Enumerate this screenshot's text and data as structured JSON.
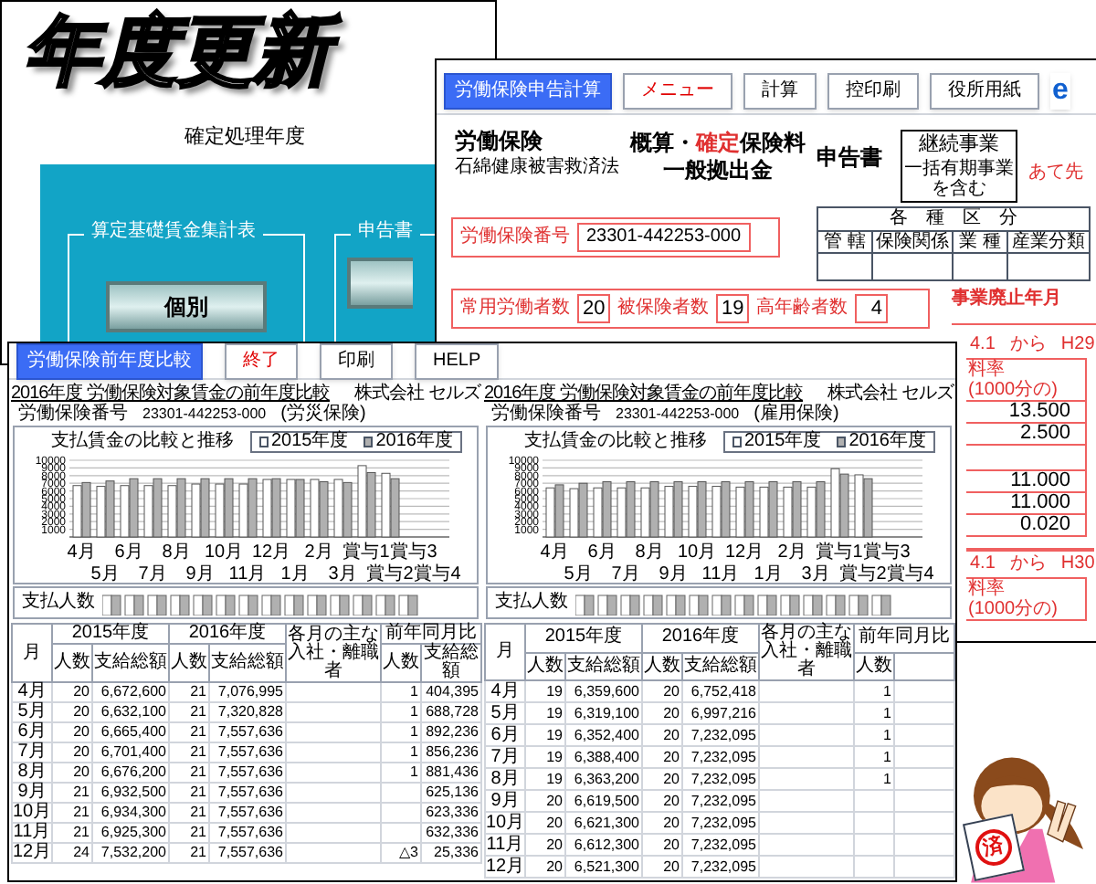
{
  "year_update_window": {
    "title": "年度更新",
    "subtitle": "確定処理年度",
    "groups": [
      {
        "label": "算定基礎賃金集計表",
        "buttons": [
          "個別"
        ]
      },
      {
        "label": "申告書"
      }
    ]
  },
  "declaration_window": {
    "toolbar": [
      {
        "label": "労働保険申告計算",
        "kind": "title"
      },
      {
        "label": "メニュー",
        "kind": "menu"
      },
      {
        "label": "計算",
        "kind": "button"
      },
      {
        "label": "控印刷",
        "kind": "button"
      },
      {
        "label": "役所用紙",
        "kind": "button"
      },
      {
        "label": "e",
        "kind": "logo"
      }
    ],
    "law_title": "労働保険",
    "law_subtitle": "石綿健康被害救済法",
    "heading_line_1": [
      {
        "text": "概算・",
        "kind": "plain"
      },
      {
        "text": "確定",
        "kind": "emphasis"
      },
      {
        "text": "保険料",
        "kind": "plain"
      }
    ],
    "heading_line_2": "一般拠出金",
    "heading_suffix": "申告書",
    "business_box": {
      "title": "継続事業",
      "note": "一括有期事業を含む"
    },
    "addressee": "あて先",
    "category_table": {
      "title": "各　種　区　分",
      "columns": [
        "管 轄",
        "保険関係",
        "業 種",
        "産業分類"
      ]
    },
    "insurance_number": {
      "label": "労働保険番号",
      "value": "23301-442253-000"
    },
    "counts": [
      {
        "label": "常用労働者数",
        "value": "20"
      },
      {
        "label": "被保険者数",
        "value": "19"
      },
      {
        "label": "高年齢者数",
        "value": "4"
      }
    ],
    "closure_label": "事業廃止年月",
    "rate_blocks": [
      {
        "from": "4.1",
        "word": "から",
        "to": "H29",
        "rate_label": "料率",
        "rate_unit": "(1000分の)",
        "rows": [
          {
            "kind": "value",
            "value": "13.500"
          },
          {
            "kind": "value",
            "value": "2.500"
          },
          {
            "kind": "blank"
          },
          {
            "kind": "value",
            "value": "11.000"
          },
          {
            "kind": "value",
            "value": "11.000"
          },
          {
            "kind": "value",
            "value": "0.020"
          }
        ]
      },
      {
        "from": "4.1",
        "word": "から",
        "to": "H30",
        "rate_label": "料率",
        "rate_unit": "(1000分の)"
      }
    ]
  },
  "comparison_window": {
    "toolbar": [
      {
        "label": "労働保険前年度比較",
        "kind": "title"
      },
      {
        "label": "終了",
        "kind": "menu"
      },
      {
        "label": "印刷",
        "kind": "button"
      },
      {
        "label": "HELP",
        "kind": "button"
      }
    ],
    "reports": [
      {
        "title": "2016年度 労働保険対象賃金の前年度比較",
        "company": "株式会社 セルズ",
        "number_label": "労働保険番号",
        "number": "23301-442253-000",
        "insurance": "(労災保険)",
        "chart_data": {
          "type": "bar",
          "title": "支払賃金の比較と推移",
          "grid": true,
          "legend": true,
          "categories": [
            "4月",
            "5月",
            "6月",
            "7月",
            "8月",
            "9月",
            "10月",
            "11月",
            "12月",
            "1月",
            "2月",
            "3月",
            "賞与1",
            "賞与2",
            "賞与3",
            "賞与4"
          ],
          "ylim": [
            0,
            10000
          ],
          "yticks": [
            1000,
            2000,
            3000,
            4000,
            5000,
            6000,
            7000,
            8000,
            9000,
            10000
          ],
          "series": [
            {
              "name": "2015年度",
              "color": "#ffffff",
              "values": [
                6700,
                6600,
                6700,
                6700,
                6700,
                6900,
                6900,
                6900,
                7500,
                7500,
                7500,
                7500,
                9300,
                8300,
                null,
                null
              ]
            },
            {
              "name": "2016年度",
              "color": "#b0b0b0",
              "values": [
                7100,
                7300,
                7600,
                7600,
                7600,
                7600,
                7600,
                7600,
                7600,
                7500,
                7200,
                7100,
                8400,
                7600,
                null,
                null
              ]
            }
          ]
        },
        "people_chart_title": "支払人数",
        "table": {
          "month_header": "月",
          "year_1": "2015年度",
          "year_2": "2016年度",
          "year_1_columns": [
            "人数",
            "支給総額"
          ],
          "year_2_columns": [
            "人数",
            "支給総額"
          ],
          "note_header": "各月の主な入社・離職者",
          "diff_header": "前年同月比",
          "diff_columns": [
            "人数",
            "支給総額"
          ],
          "rows": [
            {
              "month": "4月",
              "p1": "20",
              "a1": "6,672,600",
              "p2": "21",
              "a2": "7,076,995",
              "dp": "1",
              "da": "404,395"
            },
            {
              "month": "5月",
              "p1": "20",
              "a1": "6,632,100",
              "p2": "21",
              "a2": "7,320,828",
              "dp": "1",
              "da": "688,728"
            },
            {
              "month": "6月",
              "p1": "20",
              "a1": "6,665,400",
              "p2": "21",
              "a2": "7,557,636",
              "dp": "1",
              "da": "892,236"
            },
            {
              "month": "7月",
              "p1": "20",
              "a1": "6,701,400",
              "p2": "21",
              "a2": "7,557,636",
              "dp": "1",
              "da": "856,236"
            },
            {
              "month": "8月",
              "p1": "20",
              "a1": "6,676,200",
              "p2": "21",
              "a2": "7,557,636",
              "dp": "1",
              "da": "881,436"
            },
            {
              "month": "9月",
              "p1": "21",
              "a1": "6,932,500",
              "p2": "21",
              "a2": "7,557,636",
              "da": "625,136"
            },
            {
              "month": "10月",
              "p1": "21",
              "a1": "6,934,300",
              "p2": "21",
              "a2": "7,557,636",
              "da": "623,336"
            },
            {
              "month": "11月",
              "p1": "21",
              "a1": "6,925,300",
              "p2": "21",
              "a2": "7,557,636",
              "da": "632,336"
            },
            {
              "month": "12月",
              "p1": "24",
              "a1": "7,532,200",
              "p2": "21",
              "a2": "7,557,636",
              "dp": "△3",
              "da": "25,336"
            }
          ]
        }
      },
      {
        "title": "2016年度 労働保険対象賃金の前年度比較",
        "company": "株式会社 セルズ",
        "number_label": "労働保険番号",
        "number": "23301-442253-000",
        "insurance": "(雇用保険)",
        "chart_data": {
          "type": "bar",
          "title": "支払賃金の比較と推移",
          "grid": true,
          "legend": true,
          "categories": [
            "4月",
            "5月",
            "6月",
            "7月",
            "8月",
            "9月",
            "10月",
            "11月",
            "12月",
            "1月",
            "2月",
            "3月",
            "賞与1",
            "賞与2",
            "賞与3",
            "賞与4"
          ],
          "ylim": [
            0,
            10000
          ],
          "yticks": [
            1000,
            2000,
            3000,
            4000,
            5000,
            6000,
            7000,
            8000,
            9000,
            10000
          ],
          "series": [
            {
              "name": "2015年度",
              "color": "#ffffff",
              "values": [
                6400,
                6300,
                6400,
                6400,
                6400,
                6600,
                6600,
                6600,
                6500,
                6500,
                6500,
                6500,
                8900,
                8100,
                null,
                null
              ]
            },
            {
              "name": "2016年度",
              "color": "#b0b0b0",
              "values": [
                6800,
                7000,
                7200,
                7200,
                7200,
                7200,
                7200,
                7200,
                7200,
                7200,
                7200,
                7200,
                8200,
                7600,
                null,
                null
              ]
            }
          ]
        },
        "people_chart_title": "支払人数",
        "table": {
          "month_header": "月",
          "year_1": "2015年度",
          "year_2": "2016年度",
          "year_1_columns": [
            "人数",
            "支給総額"
          ],
          "year_2_columns": [
            "人数",
            "支給総額"
          ],
          "note_header": "各月の主な入社・離職者",
          "diff_header": "前年同月比",
          "diff_columns": [
            "人数"
          ],
          "rows": [
            {
              "month": "4月",
              "p1": "19",
              "a1": "6,359,600",
              "p2": "20",
              "a2": "6,752,418",
              "dp": "1"
            },
            {
              "month": "5月",
              "p1": "19",
              "a1": "6,319,100",
              "p2": "20",
              "a2": "6,997,216",
              "dp": "1"
            },
            {
              "month": "6月",
              "p1": "19",
              "a1": "6,352,400",
              "p2": "20",
              "a2": "7,232,095",
              "dp": "1"
            },
            {
              "month": "7月",
              "p1": "19",
              "a1": "6,388,400",
              "p2": "20",
              "a2": "7,232,095",
              "dp": "1"
            },
            {
              "month": "8月",
              "p1": "19",
              "a1": "6,363,200",
              "p2": "20",
              "a2": "7,232,095",
              "dp": "1"
            },
            {
              "month": "9月",
              "p1": "20",
              "a1": "6,619,500",
              "p2": "20",
              "a2": "7,232,095"
            },
            {
              "month": "10月",
              "p1": "20",
              "a1": "6,621,300",
              "p2": "20",
              "a2": "7,232,095"
            },
            {
              "month": "11月",
              "p1": "20",
              "a1": "6,612,300",
              "p2": "20",
              "a2": "7,232,095"
            },
            {
              "month": "12月",
              "p1": "20",
              "a1": "6,521,300",
              "p2": "20",
              "a2": "7,232,095"
            }
          ]
        }
      }
    ]
  },
  "mascot": {
    "stamp": "済"
  }
}
